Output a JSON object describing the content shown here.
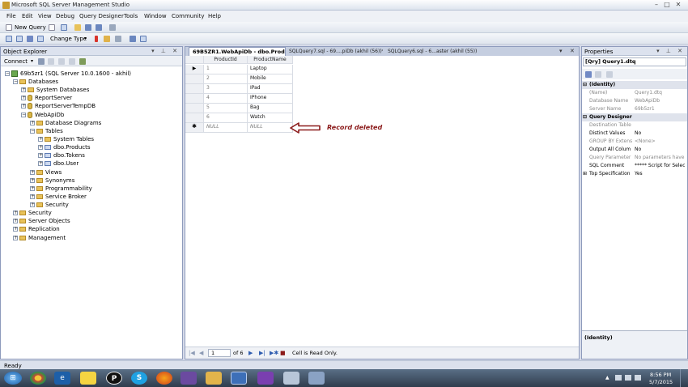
{
  "window": {
    "title": "Microsoft SQL Server Management Studio"
  },
  "menu": [
    "File",
    "Edit",
    "View",
    "Debug",
    "Query Designer",
    "Tools",
    "Window",
    "Community",
    "Help"
  ],
  "toolbar": {
    "new_query": "New Query",
    "change_type": "Change Type"
  },
  "object_explorer": {
    "title": "Object Explorer",
    "connect": "Connect",
    "tree": {
      "server": "69b5zr1 (SQL Server 10.0.1600 - akhil)",
      "databases": "Databases",
      "system_databases": "System Databases",
      "report_server": "ReportServer",
      "report_server_temp": "ReportServerTempDB",
      "webapidb": "WebApiDb",
      "db_diagrams": "Database Diagrams",
      "tables": "Tables",
      "system_tables": "System Tables",
      "products": "dbo.Products",
      "tokens": "dbo.Tokens",
      "user": "dbo.User",
      "views": "Views",
      "synonyms": "Synonyms",
      "programmability": "Programmability",
      "service_broker": "Service Broker",
      "db_security": "Security",
      "security": "Security",
      "server_objects": "Server Objects",
      "replication": "Replication",
      "management": "Management"
    }
  },
  "tabs": [
    {
      "label": "69B5ZR1.WebApiDb - dbo.Products",
      "active": true
    },
    {
      "label": "SQLQuery7.sql - 69....piDb (akhil (56))*"
    },
    {
      "label": "SQLQuery6.sql - 6...aster (akhil (55))"
    }
  ],
  "grid": {
    "columns": [
      "ProductId",
      "ProductName"
    ],
    "rows": [
      {
        "id": "1",
        "name": "Laptop"
      },
      {
        "id": "2",
        "name": "Mobile"
      },
      {
        "id": "3",
        "name": "IPad"
      },
      {
        "id": "4",
        "name": "IPhone"
      },
      {
        "id": "5",
        "name": "Bag"
      },
      {
        "id": "6",
        "name": "Watch"
      }
    ],
    "new_row": {
      "id": "NULL",
      "name": "NULL"
    }
  },
  "annotation": {
    "text": "Record deleted",
    "color": "#8b1a1a"
  },
  "nav": {
    "page": "1",
    "of": "of 6",
    "status": "Cell is Read Only."
  },
  "properties": {
    "title": "Properties",
    "object": "[Qry] Query1.dtq",
    "categories": {
      "identity": "(Identity)",
      "query_designer": "Query Designer"
    },
    "rows": [
      {
        "key": "(Name)",
        "value": "Query1.dtq"
      },
      {
        "key": "Database Name",
        "value": "WebApiDb"
      },
      {
        "key": "Server Name",
        "value": "69b5zr1"
      },
      {
        "key": "Destination Table",
        "value": ""
      },
      {
        "key": "Distinct Values",
        "value": "No"
      },
      {
        "key": "GROUP BY Extens",
        "value": "<None>"
      },
      {
        "key": "Output All Colum",
        "value": "No"
      },
      {
        "key": "Query Parameter",
        "value": "No parameters have b"
      },
      {
        "key": "SQL Comment",
        "value": "***** Script for SelectT"
      },
      {
        "key": "Top Specification",
        "value": "Yes"
      }
    ],
    "footer": "(Identity)"
  },
  "status": {
    "text": "Ready"
  },
  "clock": {
    "time": "8:56 PM",
    "date": "5/7/2015"
  },
  "colors": {
    "accent": "#3b5b98",
    "annotation": "#8b1a1a"
  }
}
